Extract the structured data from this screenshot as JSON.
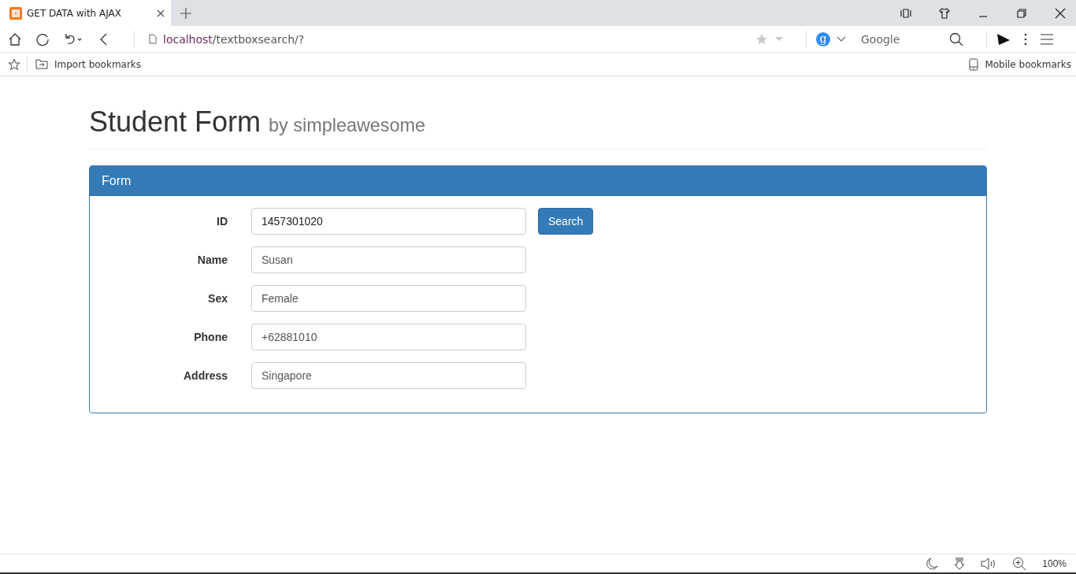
{
  "browser": {
    "tab": {
      "title": "GET DATA with AJAX",
      "selected": true
    },
    "address": {
      "host": "localhost",
      "path": "/textboxsearch/?"
    },
    "search_engine": {
      "letter": "g",
      "placeholder": "Google"
    },
    "bookmarks": {
      "import": "Import bookmarks",
      "mobile": "Mobile bookmarks"
    },
    "zoom": "100%"
  },
  "page": {
    "title": "Student Form",
    "subtitle": "by simpleawesome"
  },
  "panel": {
    "heading": "Form",
    "fields": [
      {
        "label": "ID",
        "value": "1457301020",
        "disabled": false,
        "button": "Search"
      },
      {
        "label": "Name",
        "value": "Susan",
        "disabled": true
      },
      {
        "label": "Sex",
        "value": "Female",
        "disabled": true
      },
      {
        "label": "Phone",
        "value": "+62881010",
        "disabled": true
      },
      {
        "label": "Address",
        "value": "Singapore",
        "disabled": true
      }
    ]
  }
}
